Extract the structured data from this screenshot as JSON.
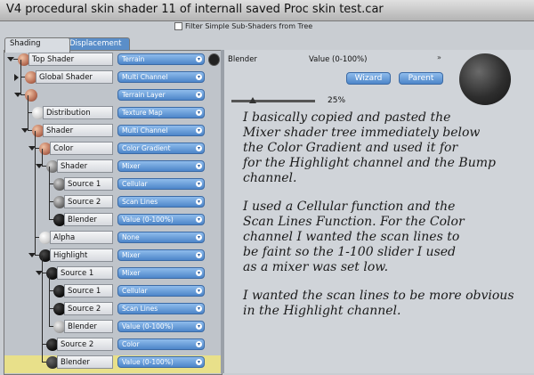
{
  "window": {
    "title": "V4 procedural skin shader 11 of internall saved Proc skin test.car"
  },
  "filter": {
    "label": "Filter Simple Sub-Shaders from Tree"
  },
  "tabs": [
    {
      "label": "Shading"
    },
    {
      "label": "Displacement"
    }
  ],
  "tree": [
    {
      "label": "Top Shader",
      "value": "Terrain",
      "ball": "skin",
      "depth": 0,
      "expand": "down",
      "highlight": false
    },
    {
      "label": "Global Shader",
      "value": "Multi Channel",
      "ball": "skin",
      "depth": 1,
      "expand": "right",
      "highlight": false
    },
    {
      "label": "",
      "value": "Terrain Layer",
      "ball": "skin",
      "depth": 1,
      "expand": "down",
      "highlight": false
    },
    {
      "label": "Distribution",
      "value": "Texture Map",
      "ball": "white",
      "depth": 2,
      "expand": "none",
      "highlight": false
    },
    {
      "label": "Shader",
      "value": "Multi Channel",
      "ball": "skin",
      "depth": 2,
      "expand": "down",
      "highlight": false
    },
    {
      "label": "Color",
      "value": "Color Gradient",
      "ball": "skin",
      "depth": 3,
      "expand": "down",
      "highlight": false
    },
    {
      "label": "Shader",
      "value": "Mixer",
      "ball": "tex",
      "depth": 4,
      "expand": "down",
      "highlight": false
    },
    {
      "label": "Source 1",
      "value": "Cellular",
      "ball": "cell",
      "depth": 5,
      "expand": "none",
      "highlight": false
    },
    {
      "label": "Source 2",
      "value": "Scan Lines",
      "ball": "cell",
      "depth": 5,
      "expand": "none",
      "highlight": false
    },
    {
      "label": "Blender",
      "value": "Value (0-100%)",
      "ball": "black",
      "depth": 5,
      "expand": "none",
      "highlight": false
    },
    {
      "label": "Alpha",
      "value": "None",
      "ball": "white",
      "depth": 3,
      "expand": "none",
      "highlight": false
    },
    {
      "label": "Highlight",
      "value": "Mixer",
      "ball": "black",
      "depth": 3,
      "expand": "down",
      "highlight": false
    },
    {
      "label": "Source 1",
      "value": "Mixer",
      "ball": "black",
      "depth": 4,
      "expand": "down",
      "highlight": false
    },
    {
      "label": "Source 1",
      "value": "Cellular",
      "ball": "black",
      "depth": 5,
      "expand": "none",
      "highlight": false
    },
    {
      "label": "Source 2",
      "value": "Scan Lines",
      "ball": "black",
      "depth": 5,
      "expand": "none",
      "highlight": false
    },
    {
      "label": "Blender",
      "value": "Value (0-100%)",
      "ball": "grey",
      "depth": 5,
      "expand": "none",
      "highlight": false
    },
    {
      "label": "Source 2",
      "value": "Color",
      "ball": "black",
      "depth": 4,
      "expand": "none",
      "highlight": false
    },
    {
      "label": "Blender",
      "value": "Value (0-100%)",
      "ball": "dark",
      "depth": 4,
      "expand": "none",
      "highlight": true
    }
  ],
  "right": {
    "title": "Blender",
    "value": "Value (0-100%)",
    "wizard": "Wizard",
    "parent": "Parent",
    "slider_value": 0.25,
    "slider_label": "25%",
    "paragraphs": [
      [
        "I basically copied and pasted the",
        "Mixer shader tree immediately below",
        "the Color Gradient and used it for",
        "for the Highlight channel and the Bump",
        "channel."
      ],
      [
        "I used a Cellular function and the",
        "Scan Lines Function. For the Color",
        "channel I wanted the scan lines to",
        "be faint so the 1-100 slider I used",
        "as a mixer was set low."
      ],
      [
        "I wanted the scan lines to be more obvious",
        "in the Highlight channel."
      ]
    ]
  },
  "colors": {
    "accent": "#4d86c9",
    "highlight_row": "#e8e08a"
  },
  "icons": {
    "dropdown": "chevron-down-icon",
    "mini_icon": "shader-preview-icon"
  }
}
